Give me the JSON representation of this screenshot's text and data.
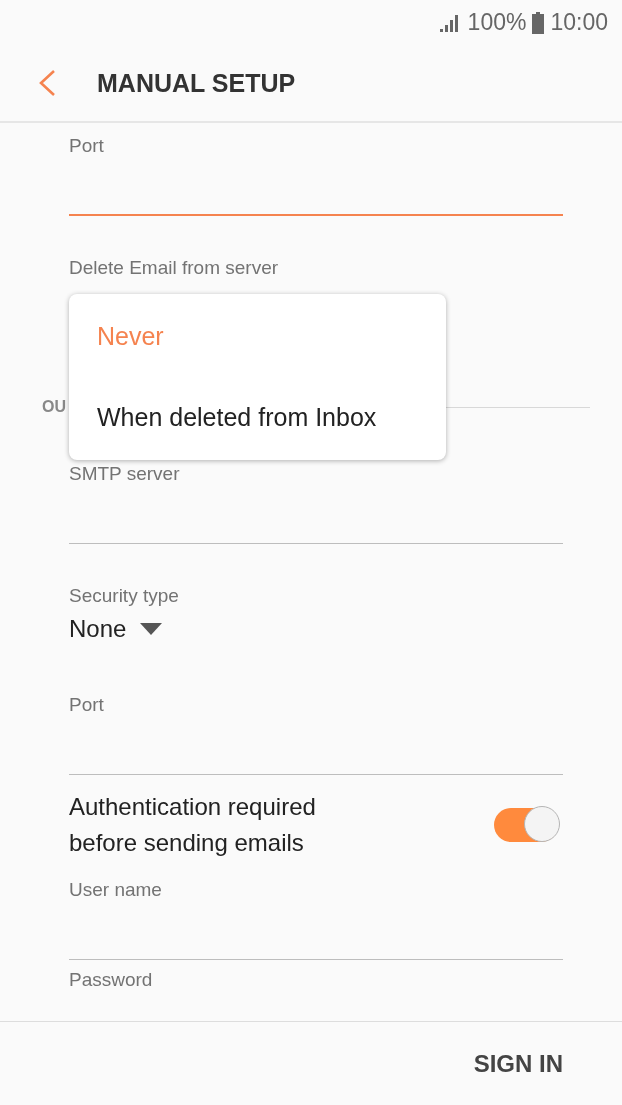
{
  "status_bar": {
    "battery": "100%",
    "time": "10:00"
  },
  "header": {
    "title": "MANUAL SETUP"
  },
  "items": [
    {
      "kind": "input",
      "label": "Port",
      "focused": true
    },
    {
      "kind": "dropdown",
      "label": "Delete Email from server"
    },
    {
      "kind": "section",
      "title": "OU"
    },
    {
      "kind": "input",
      "label": "SMTP server",
      "focused": false
    },
    {
      "kind": "select",
      "label": "Security type",
      "value": "None"
    },
    {
      "kind": "input",
      "label": "Port",
      "focused": false
    },
    {
      "kind": "toggle",
      "label": "Authentication required before sending emails",
      "on": true
    },
    {
      "kind": "input",
      "label": "User name",
      "focused": false
    },
    {
      "kind": "label",
      "label": "Password"
    }
  ],
  "popup": {
    "options": [
      {
        "label": "Never",
        "selected": true
      },
      {
        "label": "When deleted from Inbox",
        "selected": false
      }
    ]
  },
  "footer": {
    "button": "SIGN IN"
  }
}
